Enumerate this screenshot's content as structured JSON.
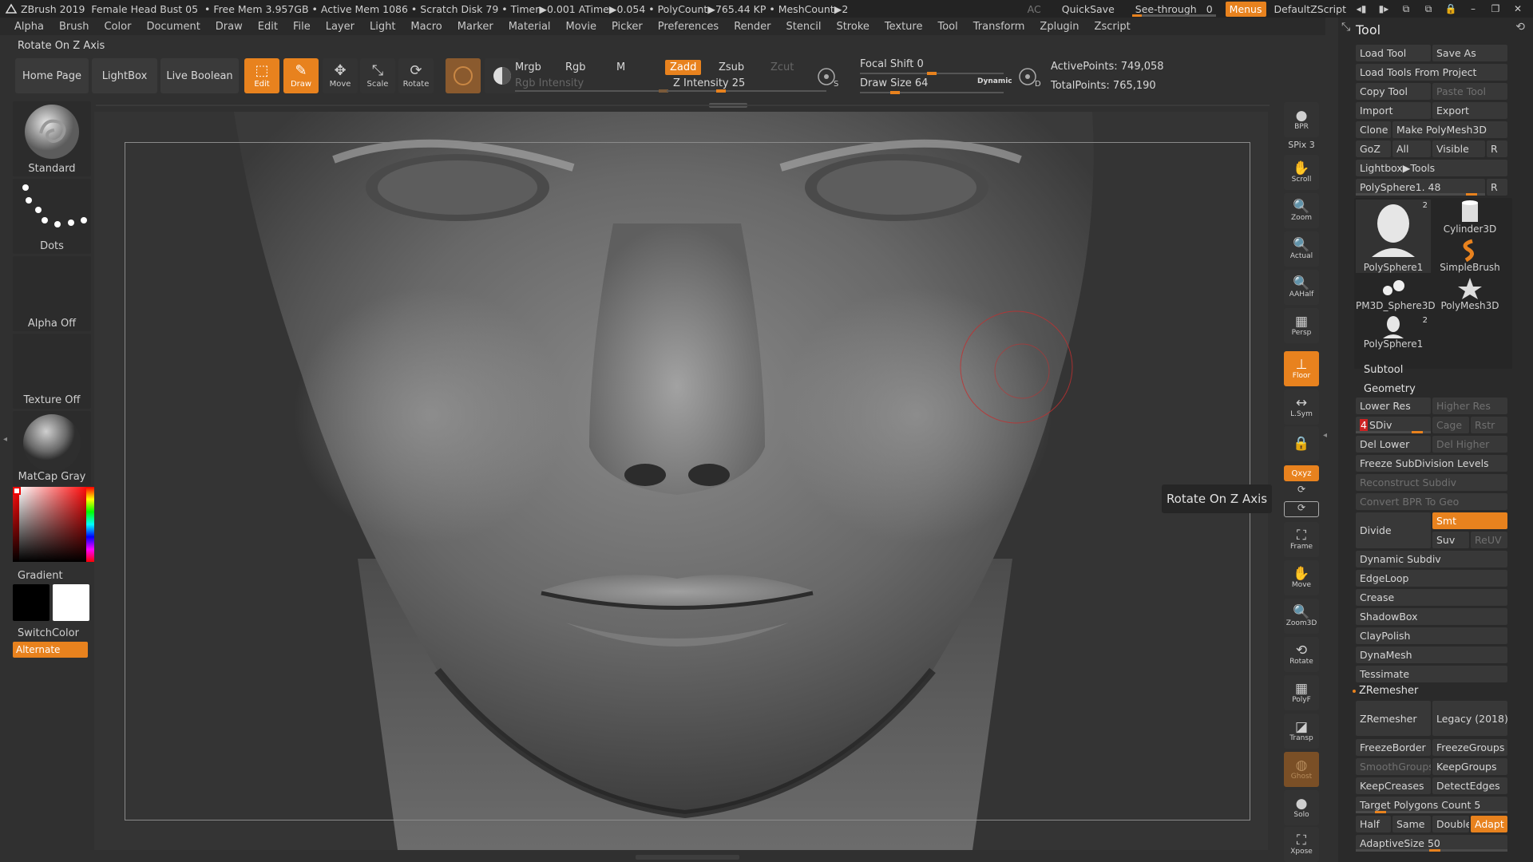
{
  "titlebar": {
    "app": "ZBrush 2019",
    "doc": "Female Head Bust 05",
    "stats": "• Free Mem 3.957GB • Active Mem 1086 • Scratch Disk 79 • Timer▶0.001 ATime▶0.054 • PolyCount▶765.44 KP • MeshCount▶2",
    "ac": "AC",
    "quicksave": "QuickSave",
    "see_through": "See-through",
    "see_through_value": "0",
    "menus": "Menus",
    "script": "DefaultZScript"
  },
  "menubar": [
    "Alpha",
    "Brush",
    "Color",
    "Document",
    "Draw",
    "Edit",
    "File",
    "Layer",
    "Light",
    "Macro",
    "Marker",
    "Material",
    "Movie",
    "Picker",
    "Preferences",
    "Render",
    "Stencil",
    "Stroke",
    "Texture",
    "Tool",
    "Transform",
    "Zplugin",
    "Zscript"
  ],
  "status_line": "Rotate On Z Axis",
  "shelf": {
    "home_page": "Home Page",
    "lightbox": "LightBox",
    "live_boolean": "Live Boolean",
    "tools": [
      {
        "label": "Edit",
        "on": true
      },
      {
        "label": "Draw",
        "on": true
      },
      {
        "label": "Move",
        "on": false
      },
      {
        "label": "Scale",
        "on": false
      },
      {
        "label": "Rotate",
        "on": false
      }
    ],
    "mrgb": "Mrgb",
    "rgb": "Rgb",
    "m": "M",
    "zadd": "Zadd",
    "zsub": "Zsub",
    "zcut": "Zcut",
    "rgb_intensity": "Rgb Intensity",
    "z_intensity": "Z Intensity 25",
    "focal_shift": "Focal Shift 0",
    "draw_size": "Draw Size 64",
    "dynamic": "Dynamic",
    "active_points": "ActivePoints: 749,058",
    "total_points": "TotalPoints: 765,190"
  },
  "leftpanel": {
    "brush": "Standard",
    "stroke": "Dots",
    "alpha": "Alpha Off",
    "texture": "Texture Off",
    "material": "MatCap Gray",
    "gradient": "Gradient",
    "switchcolor": "SwitchColor",
    "alternate": "Alternate"
  },
  "tooltip": "Rotate On Z Axis",
  "rtoolbar": [
    {
      "label": "BPR",
      "icon": "●",
      "state": "off"
    },
    {
      "label": "SPix 3",
      "icon": "",
      "state": "text"
    },
    {
      "label": "Scroll",
      "icon": "✋",
      "state": "off"
    },
    {
      "label": "Zoom",
      "icon": "🔍",
      "state": "off"
    },
    {
      "label": "Actual",
      "icon": "🔍",
      "state": "off"
    },
    {
      "label": "AAHalf",
      "icon": "🔍",
      "state": "off"
    },
    {
      "label": "Persp",
      "icon": "▦",
      "state": "off"
    },
    {
      "label": "Floor",
      "icon": "⊥",
      "state": "on"
    },
    {
      "label": "L.Sym",
      "icon": "↔",
      "state": "off"
    },
    {
      "label": "",
      "icon": "🔒",
      "state": "off"
    },
    {
      "label": "Qxyz",
      "icon": "",
      "state": "on"
    },
    {
      "label": "",
      "icon": "⟳",
      "state": "off"
    },
    {
      "label": "Frame",
      "icon": "⛶",
      "state": "off"
    },
    {
      "label": "Move",
      "icon": "✋",
      "state": "off"
    },
    {
      "label": "Zoom3D",
      "icon": "🔍",
      "state": "off"
    },
    {
      "label": "Rotate",
      "icon": "⟲",
      "state": "off"
    },
    {
      "label": "PolyF",
      "icon": "▦",
      "state": "off"
    },
    {
      "label": "Transp",
      "icon": "◪",
      "state": "off"
    },
    {
      "label": "Ghost",
      "icon": "◍",
      "state": "dimon"
    },
    {
      "label": "Solo",
      "icon": "●",
      "state": "off"
    },
    {
      "label": "Xpose",
      "icon": "⛶",
      "state": "off"
    }
  ],
  "rpanel": {
    "title": "Tool",
    "load_tool": "Load Tool",
    "save_as": "Save As",
    "load_from_project": "Load Tools From Project",
    "copy_tool": "Copy Tool",
    "paste_tool": "Paste Tool",
    "import": "Import",
    "export": "Export",
    "clone": "Clone",
    "make_polymesh": "Make PolyMesh3D",
    "goz": "GoZ",
    "all": "All",
    "visible": "Visible",
    "r": "R",
    "lightbox_tools": "Lightbox▶Tools",
    "polysphere_slider": "PolySphere1. 48",
    "thumbs": [
      {
        "label": "PolySphere1",
        "count": "2"
      },
      {
        "label": "Cylinder3D",
        "count": ""
      },
      {
        "label": "SimpleBrush",
        "count": ""
      },
      {
        "label": "PM3D_Sphere3D",
        "count": ""
      },
      {
        "label": "PolyMesh3D",
        "count": ""
      },
      {
        "label": "PolySphere1",
        "count": "2"
      }
    ],
    "subtool": "Subtool",
    "geometry": "Geometry",
    "lower_res": "Lower Res",
    "higher_res": "Higher Res",
    "sdiv_num": "4",
    "sdiv": "SDiv",
    "cage": "Cage",
    "rstr": "Rstr",
    "del_lower": "Del Lower",
    "del_higher": "Del Higher",
    "freeze_subdiv": "Freeze SubDivision Levels",
    "reconstruct": "Reconstruct Subdiv",
    "convert_bpr": "Convert BPR To Geo",
    "divide": "Divide",
    "smt": "Smt",
    "suv": "Suv",
    "reuv": "ReUV",
    "dynamic_subdiv": "Dynamic Subdiv",
    "edgeloop": "EdgeLoop",
    "crease": "Crease",
    "shadowbox": "ShadowBox",
    "claypolish": "ClayPolish",
    "dynamesh": "DynaMesh",
    "tessimate": "Tessimate",
    "zremesher_sect": "ZRemesher",
    "zremesher": "ZRemesher",
    "legacy": "Legacy (2018)",
    "freezeborder": "FreezeBorder",
    "freezegroups": "FreezeGroups",
    "smoothgroups": "SmoothGroups",
    "keepgroups": "KeepGroups",
    "keepcreases": "KeepCreases",
    "detectedges": "DetectEdges",
    "target_poly": "Target Polygons Count 5",
    "half": "Half",
    "same": "Same",
    "double": "Double",
    "adapt": "Adapt",
    "adaptive_size": "AdaptiveSize 50"
  },
  "colors": {
    "accent": "#e8821e",
    "bg": "#303030"
  }
}
